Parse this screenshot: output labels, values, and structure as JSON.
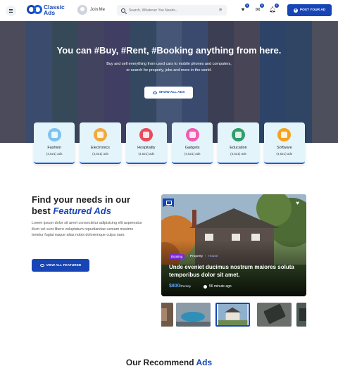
{
  "header": {
    "logo_line1": "Classic",
    "logo_line2": "Ads",
    "join_label": "Join Me",
    "search_placeholder": "Search, Whatever You Needs...",
    "wishlist_count": "0",
    "messages_count": "0",
    "notifications_count": "0",
    "post_ad_label": "POST YOUR AD"
  },
  "hero": {
    "title": "You can #Buy, #Rent, #Booking anything from here.",
    "subtitle": "Buy and sell everything from used cars to mobile phones and computers, or search for property, jobs and more in the world.",
    "show_all_label": "SHOW ALL ADS"
  },
  "categories": [
    {
      "name": "Fashion",
      "count": "(4,521) ads",
      "color": "#7ec3f0"
    },
    {
      "name": "Electronics",
      "count": "(4,521) ads",
      "color": "#f2a93b"
    },
    {
      "name": "Hospitality",
      "count": "(4,521) ads",
      "color": "#e84b5c"
    },
    {
      "name": "Gadgets",
      "count": "(4,521) ads",
      "color": "#f05bb3"
    },
    {
      "name": "Education",
      "count": "(4,521) ads",
      "color": "#2f9e6b"
    },
    {
      "name": "Software",
      "count": "(4,521) ads",
      "color": "#f5a21c"
    }
  ],
  "featured": {
    "title_line1": "Find your needs in our",
    "title_prefix": "best",
    "title_highlight": "Featured Ads",
    "description": "Lorem ipsum dolor sit amet consectetur adipisicing elit aspernatur illum vel sunt libero voluptatum repudiandae veniam maxime tenetur fugiat eaque alias nobis doloremque culpa nam.",
    "view_label": "VIEW ALL FEATURED"
  },
  "featured_card": {
    "tag": "Booking",
    "category": "Property",
    "subcategory": "House",
    "title": "Unde eveniet ducimus nostrum maiores soluta temporibus dolor sit amet.",
    "price": "$800",
    "price_unit": "/Perday",
    "time": "56 minute ago"
  },
  "recommend": {
    "prefix": "Our Recommend",
    "highlight": "Ads"
  },
  "colors": {
    "brand": "#1745b5",
    "category_bg": "#e3f4fb"
  }
}
